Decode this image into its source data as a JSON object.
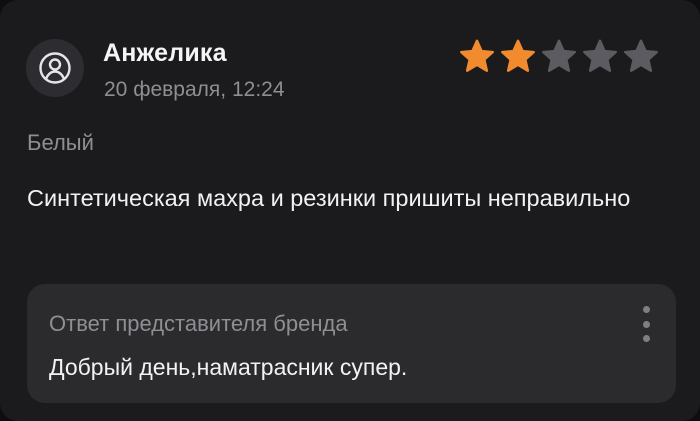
{
  "review": {
    "author": "Анжелика",
    "date": "20 февраля, 12:24",
    "rating": 2,
    "max_rating": 5,
    "variant": "Белый",
    "text": "Синтетическая махра и резинки пришиты неправильно",
    "avatar_icon": "user-circle-icon"
  },
  "reply": {
    "title": "Ответ представителя бренда",
    "body": "Добрый день,наматрасник супер.",
    "more_icon": "more-vertical-icon"
  },
  "colors": {
    "star_filled": "#f28a2e",
    "star_empty": "#5b5b61",
    "card_bg": "#1b1b1d",
    "reply_bg": "#2b2b2e",
    "muted_text": "#8e8e93"
  }
}
